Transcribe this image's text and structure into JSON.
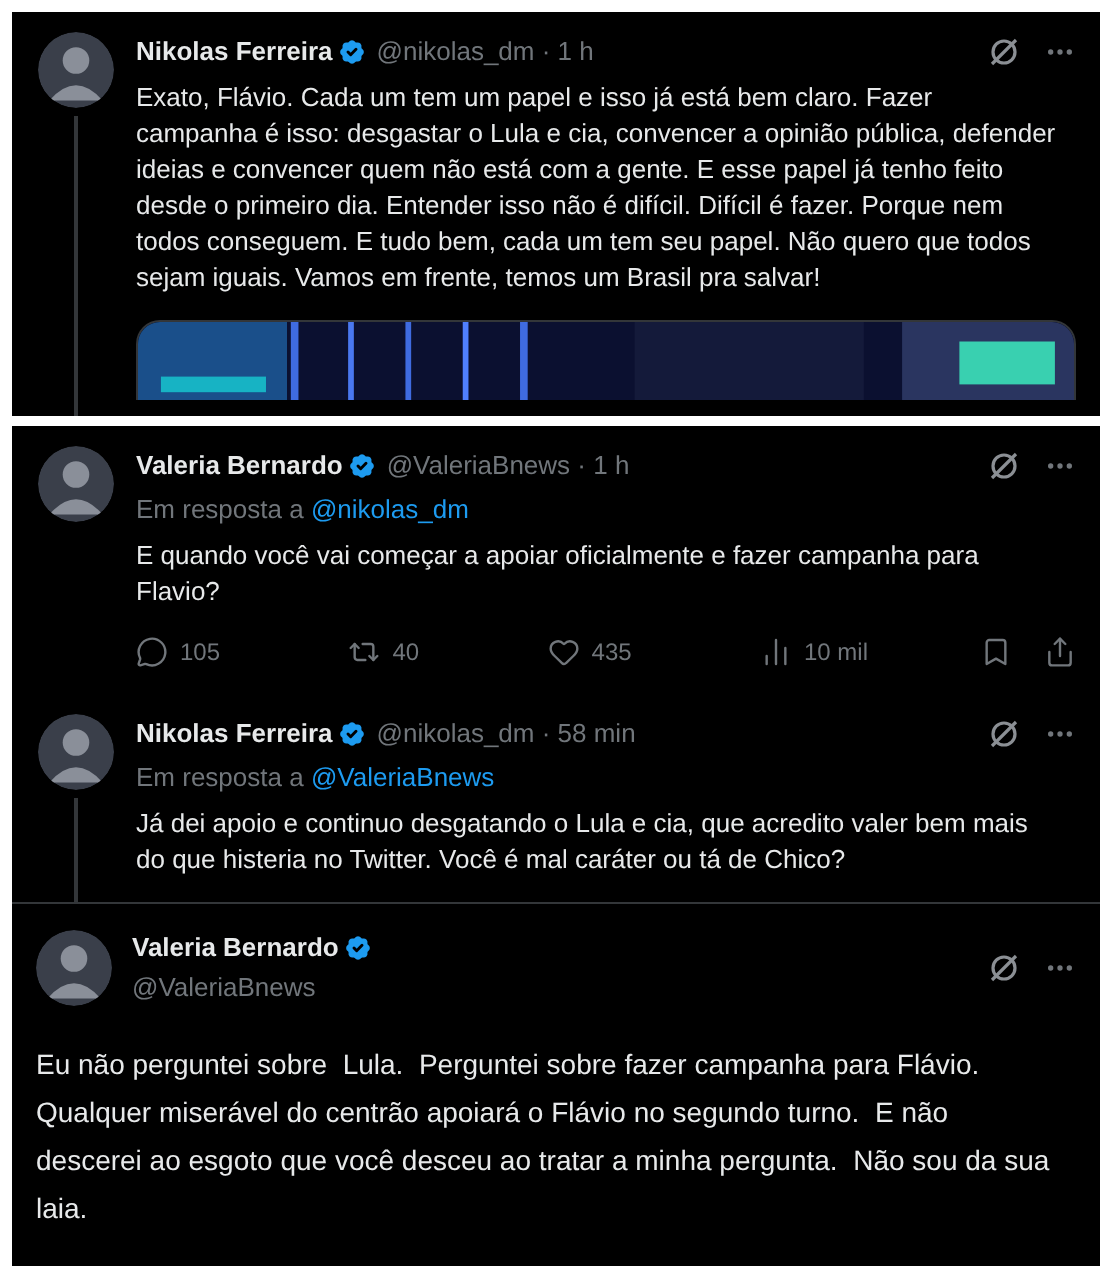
{
  "panels": [
    {
      "tweets": [
        {
          "kind": "reply",
          "author": "Nikolas Ferreira",
          "verified": true,
          "meta": "@nikolas_dm · 1 h",
          "text": "Exato, Flávio. Cada um tem um papel e isso já está bem claro. Fazer campanha é isso: desgastar o Lula e cia, convencer a opinião pública, defender ideias e convencer quem não está com a gente. E esse papel já tenho feito desde o primeiro dia. Entender isso não é difícil. Difícil é fazer. Porque nem todos conseguem. E tudo bem, cada um tem seu papel. Não quero que todos sejam iguais. Vamos em frente, temos um Brasil pra salvar!",
          "thread_line": true
        }
      ]
    },
    {
      "tweets": [
        {
          "kind": "reply",
          "author": "Valeria Bernardo",
          "verified": true,
          "meta": "@ValeriaBnews · 1 h",
          "reply_prefix": "Em resposta a",
          "reply_to": "@nikolas_dm",
          "text": "E quando você vai começar a apoiar oficialmente e fazer campanha para Flavio?",
          "thread_line": false,
          "stats": [
            {
              "kind": "reply",
              "value": "105"
            },
            {
              "kind": "repost",
              "value": "40"
            },
            {
              "kind": "like",
              "value": "435"
            },
            {
              "kind": "views",
              "value": "10 mil"
            }
          ]
        },
        {
          "kind": "reply",
          "author": "Nikolas Ferreira",
          "verified": true,
          "meta": "@nikolas_dm · 58 min",
          "reply_prefix": "Em resposta a",
          "reply_to": "@ValeriaBnews",
          "text": "Já dei apoio e continuo desgatando o Lula e cia, que acredito valer bem mais do que histeria no Twitter. Você é mal caráter ou tá de Chico?",
          "thread_line": true
        },
        {
          "kind": "focused",
          "author": "Valeria Bernardo",
          "verified": true,
          "handle": "@ValeriaBnews",
          "text": "Eu não perguntei sobre  Lula.  Perguntei sobre fazer campanha para Flávio.  Qualquer miserável do centrão apoiará o Flávio no segundo turno.  E não descerei ao esgoto que você desceu ao tratar a minha pergunta.  Não sou da sua laia."
        }
      ]
    }
  ]
}
